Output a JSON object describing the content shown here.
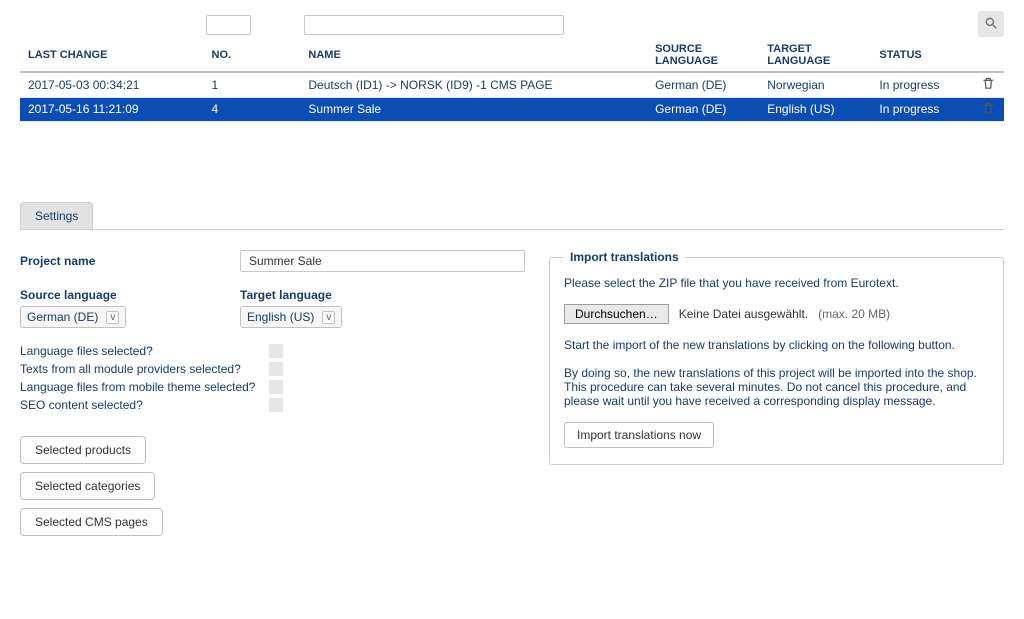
{
  "grid": {
    "headers": {
      "lastchange": "LAST CHANGE",
      "no": "NO.",
      "name": "NAME",
      "src": "SOURCE LANGUAGE",
      "tgt": "TARGET LANGUAGE",
      "status": "STATUS"
    },
    "rows": [
      {
        "lastchange": "2017-05-03 00:34:21",
        "no": "1",
        "name": "Deutsch (ID1) -> NORSK (ID9) -1 CMS PAGE",
        "src": "German (DE)",
        "tgt": "Norwegian",
        "status": "In progress",
        "selected": false
      },
      {
        "lastchange": "2017-05-16 11:21:09",
        "no": "4",
        "name": "Summer Sale",
        "src": "German (DE)",
        "tgt": "English (US)",
        "status": "In progress",
        "selected": true
      }
    ]
  },
  "tabs": {
    "settings": "Settings"
  },
  "settings": {
    "project_name_label": "Project name",
    "project_name_value": "Summer Sale",
    "source_lang_label": "Source language",
    "source_lang_value": "German (DE)",
    "target_lang_label": "Target language",
    "target_lang_value": "English (US)",
    "checks": {
      "lang_files": "Language files selected?",
      "module_texts": "Texts from all module providers selected?",
      "mobile_theme": "Language files from mobile theme selected?",
      "seo": "SEO content selected?"
    },
    "buttons": {
      "products": "Selected products",
      "categories": "Selected categories",
      "cmspages": "Selected CMS pages"
    }
  },
  "import": {
    "legend": "Import translations",
    "intro": "Please select the ZIP file that you have received from Eurotext.",
    "file_btn": "Durchsuchen…",
    "file_status": "Keine Datei ausgewählt.",
    "file_hint": "(max. 20 MB)",
    "start_hint": "Start the import of the new translations by clicking on the following button.",
    "warn1": "By doing so, the new translations of this project will be imported into the shop.",
    "warn2": "This procedure can take several minutes. Do not cancel this procedure, and please wait until you have received a corresponding display message.",
    "import_btn": "Import translations now"
  }
}
